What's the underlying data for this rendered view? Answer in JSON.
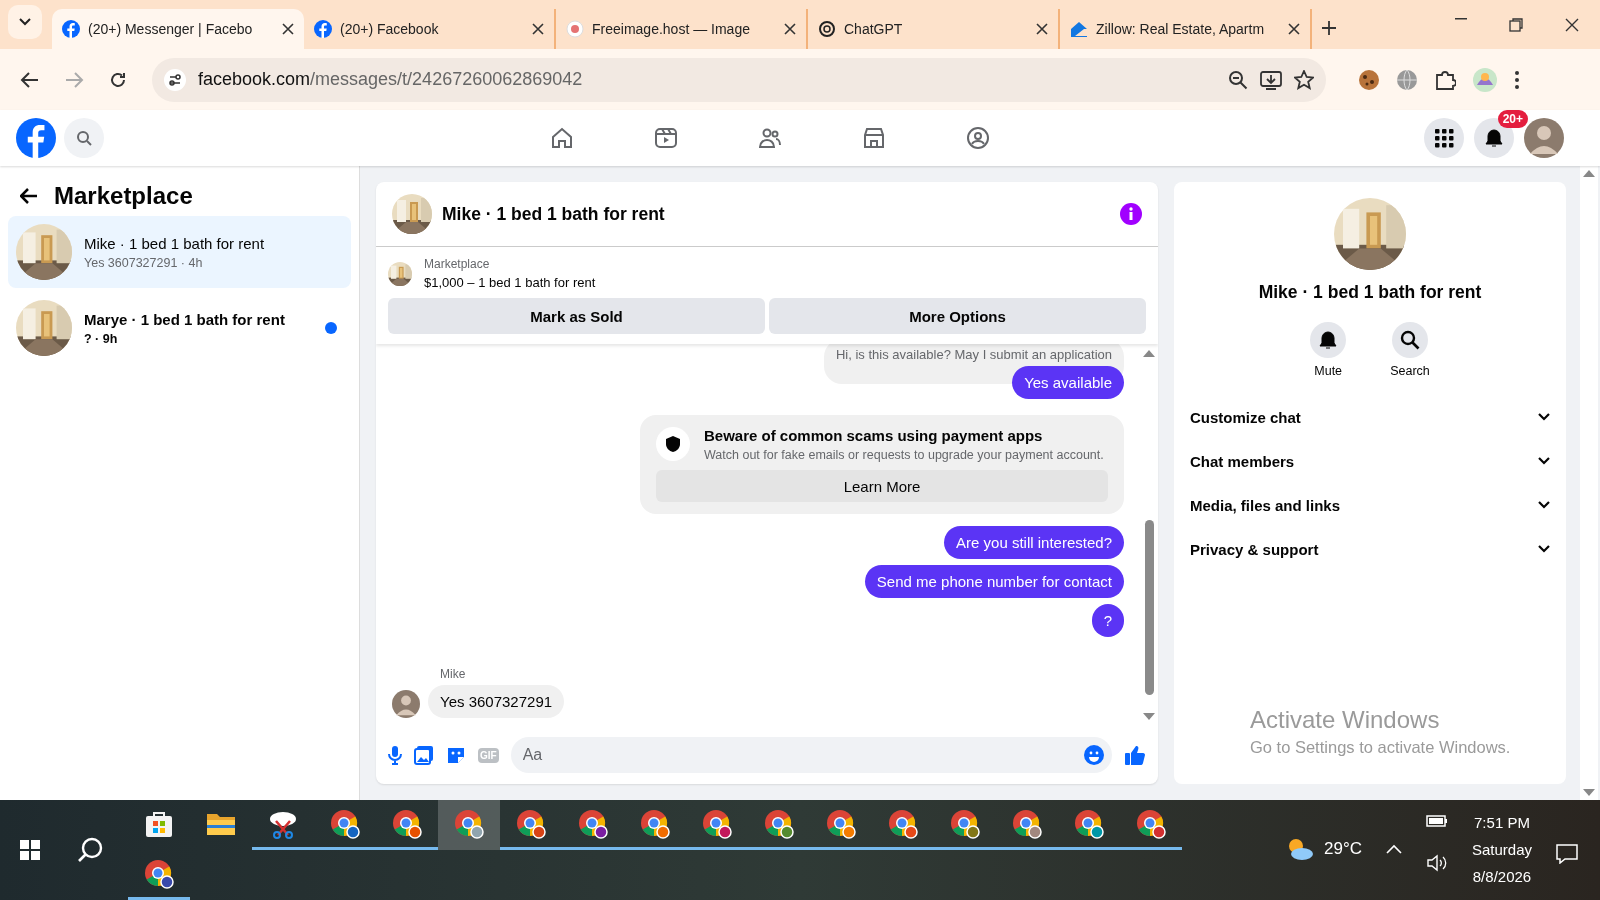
{
  "browser": {
    "tabs": [
      {
        "title": "(20+) Messenger | Facebo",
        "kind": "facebook",
        "selected": true
      },
      {
        "title": "(20+) Facebook",
        "kind": "facebook",
        "selected": false
      },
      {
        "title": "Freeimage.host — Image",
        "kind": "freeimage",
        "selected": false
      },
      {
        "title": "ChatGPT",
        "kind": "chatgpt",
        "selected": false
      },
      {
        "title": "Zillow: Real Estate, Apartm",
        "kind": "zillow",
        "selected": false
      }
    ],
    "url_host": "facebook.com",
    "url_path": "/messages/t/24267260062869042"
  },
  "header": {
    "notifications": "20+"
  },
  "sidebar": {
    "title": "Marketplace",
    "conversations": [
      {
        "name": "Mike · 1 bed 1 bath for rent",
        "preview": "Yes 3607327291 · 4h",
        "selected": true,
        "unread": false
      },
      {
        "name": "Marye · 1 bed 1 bath for rent",
        "preview": "? · 9h",
        "selected": false,
        "unread": true
      }
    ]
  },
  "chat": {
    "title": "Mike · 1 bed 1 bath for rent",
    "listing": {
      "label": "Marketplace",
      "title": "$1,000 – 1 bed 1 bath for rent"
    },
    "buttons": [
      "Mark as Sold",
      "More Options"
    ],
    "messages": [
      {
        "kind": "quoted",
        "text": "Hi, is this available? May I submit an application"
      },
      {
        "kind": "outgoing",
        "text": "Yes available"
      },
      {
        "kind": "notice",
        "title": "Beware of common scams using payment apps",
        "text": "Watch out for fake emails or requests to upgrade your payment account.",
        "button": "Learn More"
      },
      {
        "kind": "outgoing",
        "text": "Are you still interested?"
      },
      {
        "kind": "outgoing",
        "text": "Send me phone number for contact"
      },
      {
        "kind": "outgoing",
        "text": "?"
      },
      {
        "kind": "incoming",
        "sender": "Mike",
        "text": "Yes 3607327291"
      }
    ],
    "composer": {
      "gif": "GIF",
      "placeholder": "Aa"
    }
  },
  "details": {
    "name": "Mike · 1 bed 1 bath for rent",
    "actions": [
      {
        "kind": "mute",
        "label": "Mute"
      },
      {
        "kind": "search",
        "label": "Search"
      }
    ],
    "sections": [
      "Customize chat",
      "Chat members",
      "Media, files and links",
      "Privacy & support"
    ]
  },
  "activation": {
    "title": "Activate Windows",
    "text": "Go to Settings to activate Windows."
  },
  "taskbar": {
    "apps": [
      {
        "kind": "store",
        "selected": false,
        "running": false
      },
      {
        "kind": "folder",
        "selected": false,
        "running": false
      },
      {
        "kind": "snip",
        "selected": false,
        "running": true
      },
      {
        "kind": "chrome",
        "color": "#1565c0",
        "selected": false,
        "running": true
      },
      {
        "kind": "chrome",
        "color": "#e65100",
        "selected": false,
        "running": true
      },
      {
        "kind": "chrome",
        "color": "#90a4ae",
        "selected": true,
        "running": false
      },
      {
        "kind": "chrome",
        "color": "#d84315",
        "selected": false,
        "running": true
      },
      {
        "kind": "chrome",
        "color": "#7b1fa2",
        "selected": false,
        "running": true
      },
      {
        "kind": "chrome",
        "color": "#ef6c00",
        "selected": false,
        "running": true
      },
      {
        "kind": "chrome",
        "color": "#c2185b",
        "selected": false,
        "running": true
      },
      {
        "kind": "chrome",
        "color": "#558b2f",
        "selected": false,
        "running": true
      },
      {
        "kind": "chrome",
        "color": "#f57c00",
        "selected": false,
        "running": true
      },
      {
        "kind": "chrome",
        "color": "#e64a19",
        "selected": false,
        "running": true
      },
      {
        "kind": "chrome",
        "color": "#827717",
        "selected": false,
        "running": true
      },
      {
        "kind": "chrome",
        "color": "#a1887f",
        "selected": false,
        "running": true
      },
      {
        "kind": "chrome",
        "color": "#0097a7",
        "selected": false,
        "running": true
      },
      {
        "kind": "chrome",
        "color": "#d32f2f",
        "selected": false,
        "running": true
      },
      {
        "kind": "chrome",
        "color": "#3949ab",
        "selected": false,
        "running": true
      }
    ],
    "temperature": "29°C",
    "time": "7:51 PM",
    "day": "Saturday",
    "date": "8/8/2026"
  }
}
